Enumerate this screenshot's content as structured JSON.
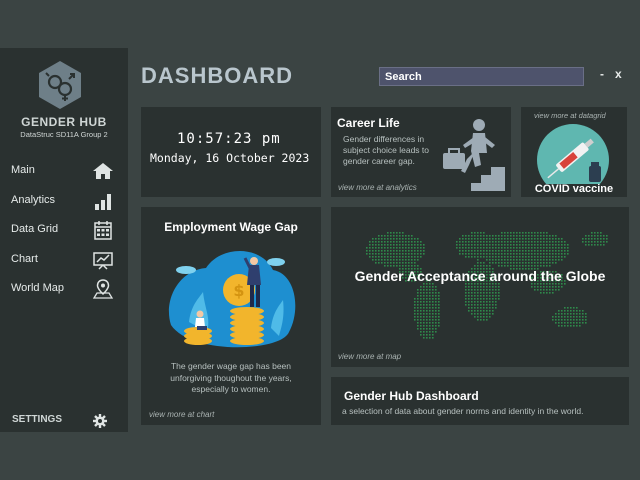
{
  "sidebar": {
    "brand": "GENDER HUB",
    "group": "DataStruc SD11A Group 2",
    "items": [
      {
        "label": "Main",
        "icon": "home-icon"
      },
      {
        "label": "Analytics",
        "icon": "bar-chart-icon"
      },
      {
        "label": "Data Grid",
        "icon": "calendar-grid-icon"
      },
      {
        "label": "Chart",
        "icon": "presentation-chart-icon"
      },
      {
        "label": "World Map",
        "icon": "map-pin-icon"
      }
    ],
    "settings_label": "SETTINGS"
  },
  "header": {
    "title": "DASHBOARD",
    "search_placeholder": "Search",
    "minimize": "-",
    "close": "x"
  },
  "clock": {
    "time": "10:57:23 pm",
    "date": "Monday, 16 October 2023"
  },
  "career": {
    "title": "Career Life",
    "description": "Gender differences in subject choice leads to gender career gap.",
    "more": "view more at analytics"
  },
  "covid": {
    "more": "view more at datagrid",
    "title": "COVID vaccine"
  },
  "wage": {
    "title": "Employment Wage Gap",
    "description": "The gender wage gap has been unforgiving thoughout the years, especially to women.",
    "more": "view more at chart"
  },
  "globe": {
    "title": "Gender Acceptance around the Globe",
    "more": "view more at map"
  },
  "about": {
    "title": "Gender Hub Dashboard",
    "description": "a selection of data about gender norms and identity in the world."
  },
  "colors": {
    "background": "#3b4443",
    "panel": "#2a3130",
    "accent_teal": "#5fb7b0",
    "map_dots": "#2f8a4a",
    "search_bg": "#4e536c"
  }
}
